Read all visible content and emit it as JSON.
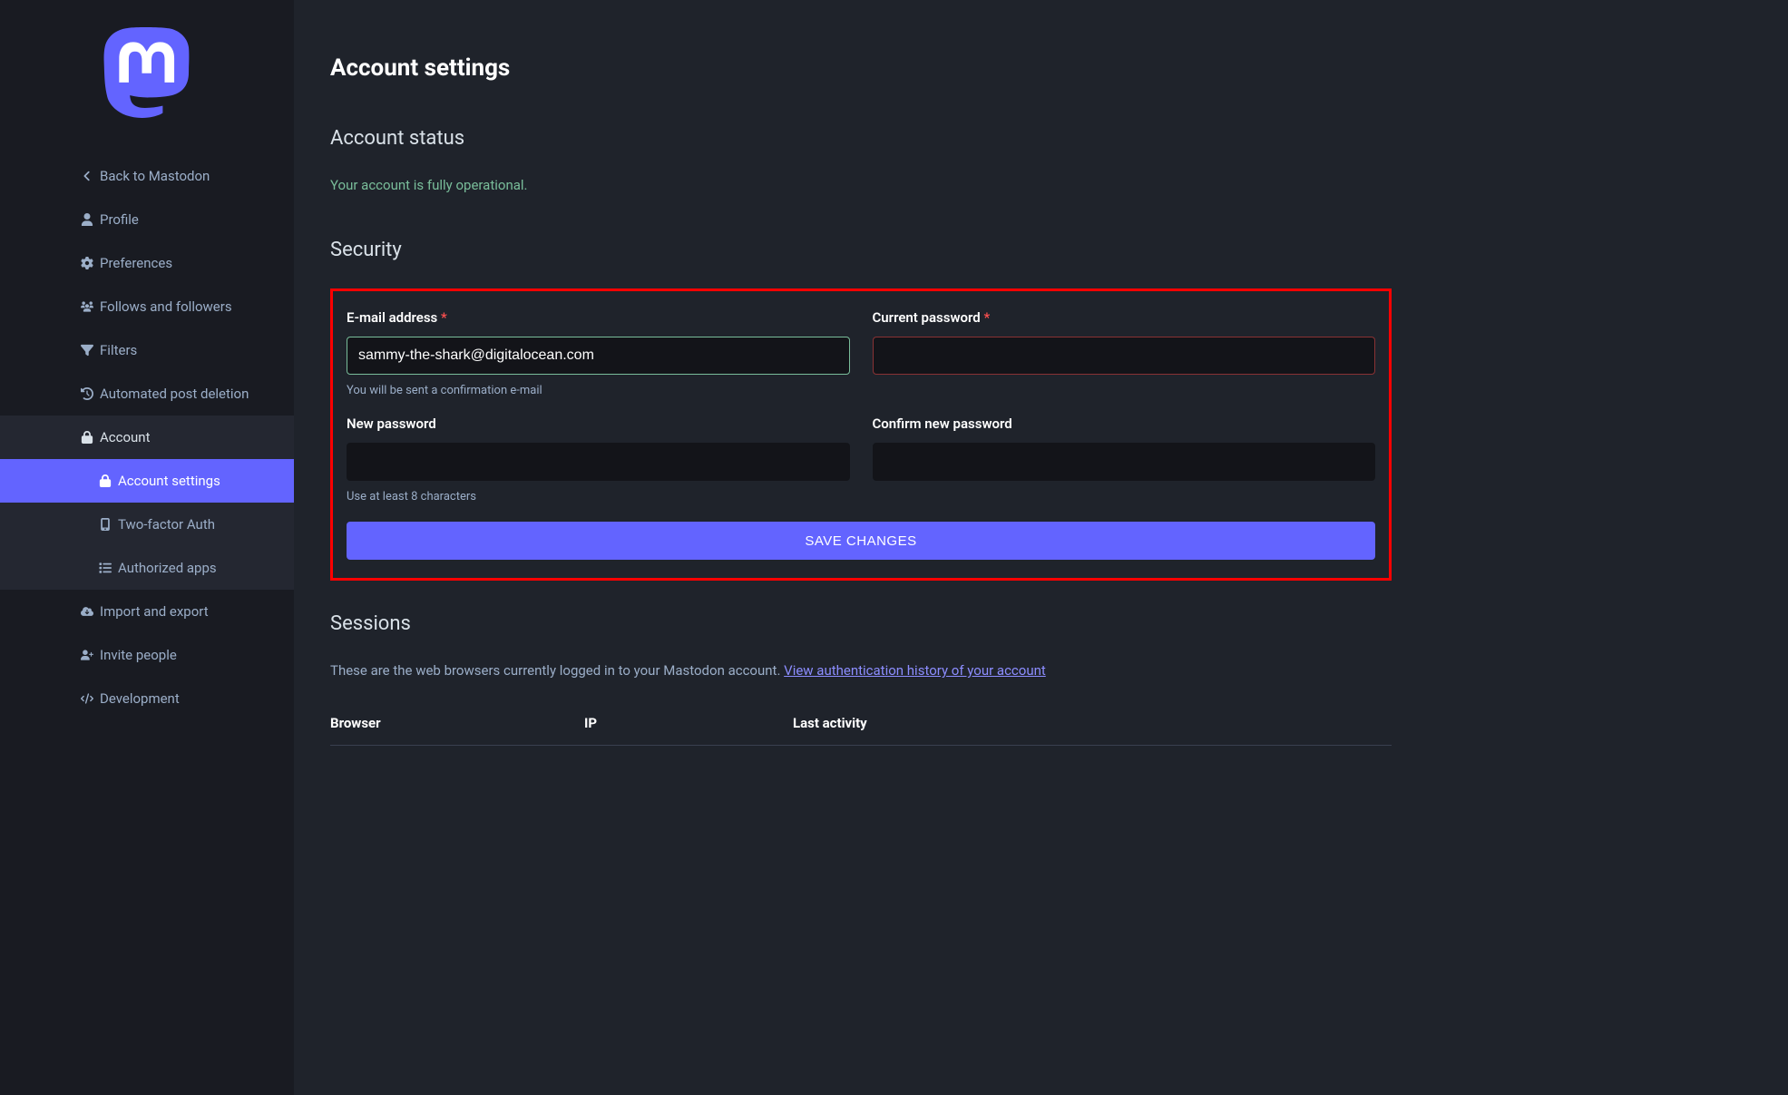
{
  "sidebar": {
    "back": "Back to Mastodon",
    "items": [
      {
        "label": "Profile",
        "icon": "user-icon"
      },
      {
        "label": "Preferences",
        "icon": "gear-icon"
      },
      {
        "label": "Follows and followers",
        "icon": "users-icon"
      },
      {
        "label": "Filters",
        "icon": "filter-icon"
      },
      {
        "label": "Automated post deletion",
        "icon": "history-icon"
      },
      {
        "label": "Account",
        "icon": "lock-icon"
      },
      {
        "label": "Import and export",
        "icon": "cloud-download-icon"
      },
      {
        "label": "Invite people",
        "icon": "invite-icon"
      },
      {
        "label": "Development",
        "icon": "code-icon"
      }
    ],
    "account_subitems": [
      {
        "label": "Account settings",
        "icon": "lock-icon",
        "active": true
      },
      {
        "label": "Two-factor Auth",
        "icon": "mobile-icon"
      },
      {
        "label": "Authorized apps",
        "icon": "list-icon"
      }
    ]
  },
  "page": {
    "title": "Account settings"
  },
  "status": {
    "heading": "Account status",
    "message": "Your account is fully operational."
  },
  "security": {
    "heading": "Security",
    "email_label": "E-mail address",
    "email_value": "sammy-the-shark@digitalocean.com",
    "email_help": "You will be sent a confirmation e-mail",
    "current_password_label": "Current password",
    "new_password_label": "New password",
    "new_password_help": "Use at least 8 characters",
    "confirm_password_label": "Confirm new password",
    "save_button": "SAVE CHANGES",
    "required_mark": "*"
  },
  "sessions": {
    "heading": "Sessions",
    "description": "These are the web browsers currently logged in to your Mastodon account. ",
    "link_text": "View authentication history of your account",
    "columns": {
      "browser": "Browser",
      "ip": "IP",
      "activity": "Last activity"
    }
  }
}
